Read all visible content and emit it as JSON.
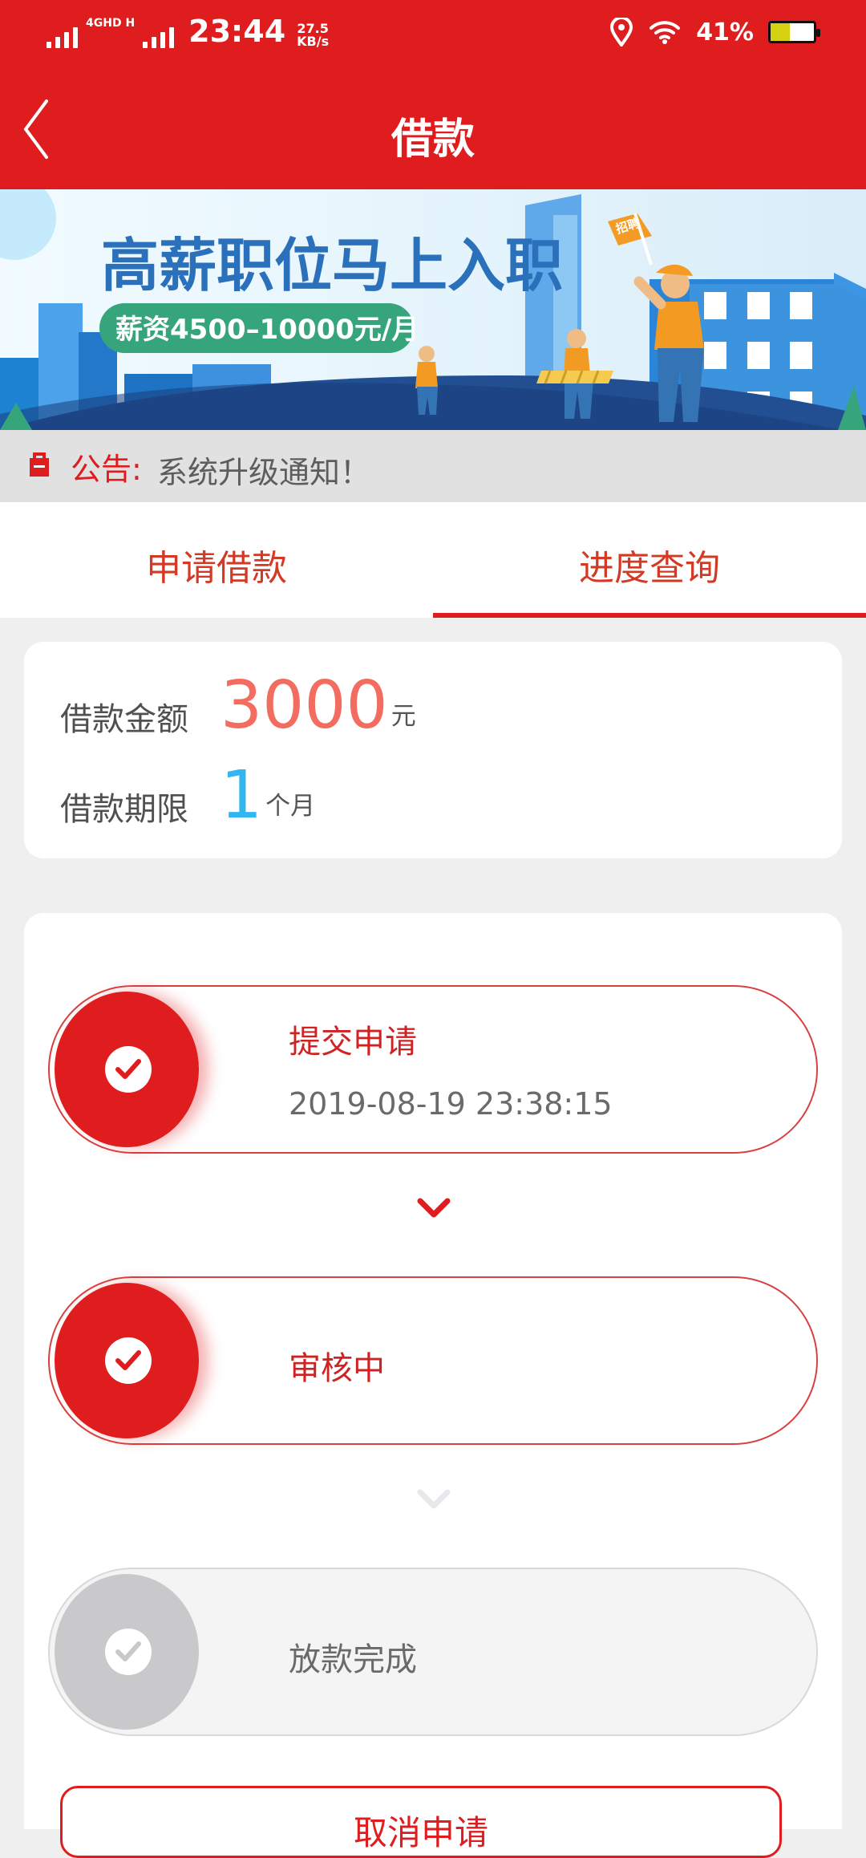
{
  "status_bar": {
    "network": "4GHD H",
    "time": "23:44",
    "speed_value": "27.5",
    "speed_unit": "KB/s",
    "battery": "41%"
  },
  "header": {
    "title": "借款"
  },
  "banner": {
    "headline": "高薪职位马上入职",
    "salary": "薪资4500–10000元/月",
    "flag": "招聘"
  },
  "notice": {
    "label": "公告:",
    "text": "系统升级通知！"
  },
  "tabs": [
    {
      "label": "申请借款"
    },
    {
      "label": "进度查询"
    }
  ],
  "summary": {
    "amount_label": "借款金额",
    "amount_value": "3000",
    "amount_unit": "元",
    "term_label": "借款期限",
    "term_value": "1",
    "term_unit": "个月"
  },
  "progress": [
    {
      "title": "提交申请",
      "time": "2019-08-19 23:38:15",
      "status": "done"
    },
    {
      "title": "审核中",
      "time": "",
      "status": "done"
    },
    {
      "title": "放款完成",
      "time": "",
      "status": "pending"
    }
  ],
  "actions": {
    "cancel_label": "取消申请"
  },
  "colors": {
    "brand_red": "#df1d1f",
    "amount_color": "#f26d60",
    "term_color": "#32b6f0"
  }
}
